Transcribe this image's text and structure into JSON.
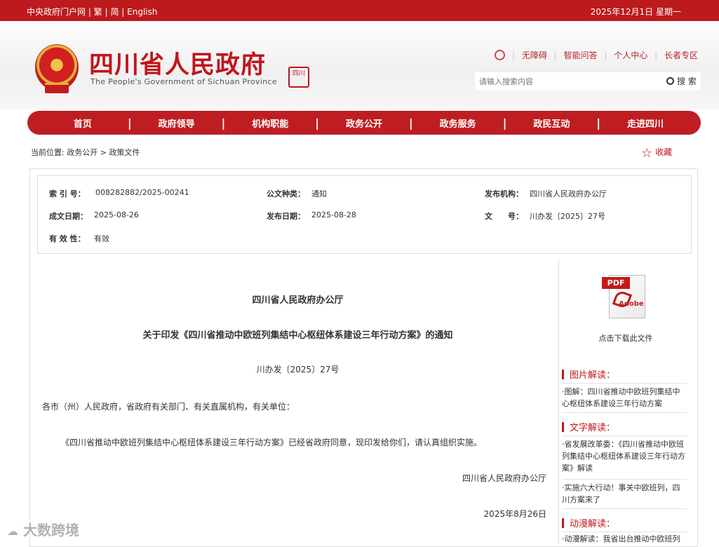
{
  "topbar": {
    "links": [
      "中央政府门户网",
      "|",
      "繁",
      "|",
      "简",
      "|",
      "English"
    ],
    "date": "2025年12月1日 星期一"
  },
  "header": {
    "title": "四川省人民政府",
    "subtitle": "The People's Government of Sichuan Province",
    "seal_text": "四川",
    "quick_links": [
      "无障碍",
      "智能问答",
      "个人中心",
      "长者专区"
    ],
    "search_placeholder": "请输入搜索内容",
    "search_button": "搜 索"
  },
  "nav": [
    "首页",
    "政府领导",
    "机构职能",
    "政务公开",
    "政务服务",
    "政民互动",
    "走进四川"
  ],
  "breadcrumb": {
    "prefix": "当前位置:",
    "items": [
      "政务公开",
      "政策文件"
    ],
    "sep": ">"
  },
  "favorite_label": "收藏",
  "meta": {
    "index_label": "索 引 号：",
    "index_value": "008282882/2025-00241",
    "type_label": "公文种类：",
    "type_value": "通知",
    "issuer_label": "发布机构：",
    "issuer_value": "四川省人民政府办公厅",
    "created_label": "成文日期：",
    "created_value": "2025-08-26",
    "published_label": "发布日期：",
    "published_value": "2025-08-28",
    "docno_label": "文　　号：",
    "docno_value": "川办发〔2025〕27号",
    "validity_label": "有 效 性：",
    "validity_value": "有效"
  },
  "article": {
    "org": "四川省人民政府办公厅",
    "title": "关于印发《四川省推动中欧班列集结中心枢纽体系建设三年行动方案》的通知",
    "number": "川办发〔2025〕27号",
    "addressee": "各市（州）人民政府，省政府有关部门、有关直属机构，有关单位：",
    "body": "《四川省推动中欧班列集结中心枢纽体系建设三年行动方案》已经省政府同意，现印发给你们，请认真组织实施。",
    "signature": "四川省人民政府办公厅",
    "date": "2025年8月26日"
  },
  "side": {
    "pdf_tag": "PDF",
    "pdf_brand": "Adobe",
    "download_label": "点击下载此文件",
    "sections": [
      {
        "title": "图片解读：",
        "items": [
          "·图解：四川省推动中欧班列集结中心枢纽体系建设三年行动方案"
        ]
      },
      {
        "title": "文字解读：",
        "items": [
          "·省发展改革委：《四川省推动中欧班列集结中心枢纽体系建设三年行动方案》解读",
          "·实施六大行动！事关中欧班列，四川方案来了"
        ]
      },
      {
        "title": "动漫解读：",
        "items": [
          "·动漫解读：我省出台推动中欧班列"
        ]
      }
    ]
  },
  "watermark": "大数跨境",
  "colors": {
    "brand_red": "#be1e22",
    "title_red": "#c0161b"
  }
}
